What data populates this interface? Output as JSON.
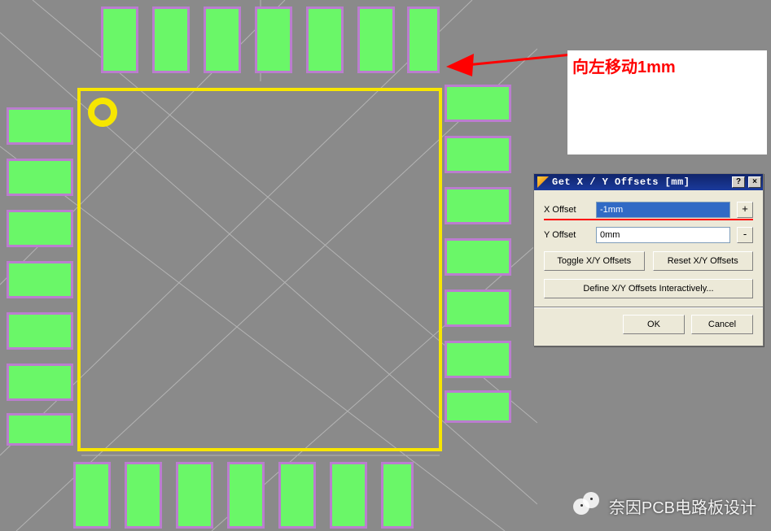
{
  "annotation": {
    "note_text": "向左移动1mm"
  },
  "dialog": {
    "title": "Get X / Y Offsets [mm]",
    "help_label": "?",
    "close_label": "×",
    "x_offset_label": "X Offset",
    "x_offset_value": "-1mm",
    "x_offset_sign": "+",
    "y_offset_label": "Y Offset",
    "y_offset_value": "0mm",
    "y_offset_sign": "-",
    "toggle_label": "Toggle X/Y Offsets",
    "reset_label": "Reset X/Y Offsets",
    "interactive_label": "Define X/Y Offsets Interactively...",
    "ok_label": "OK",
    "cancel_label": "Cancel"
  },
  "watermark": {
    "text": "奈因PCB电路板设计"
  }
}
